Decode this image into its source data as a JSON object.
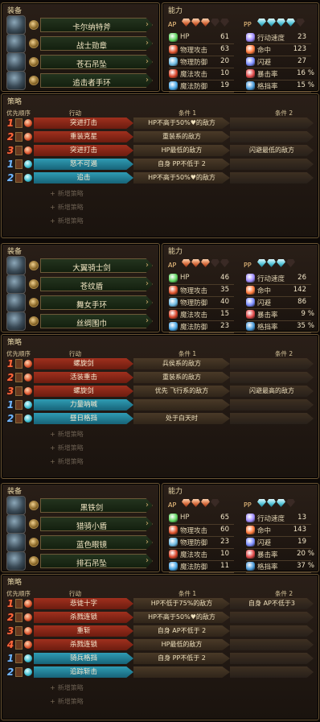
{
  "sections": [
    {
      "equip_title": "装备",
      "stats_title": "能力",
      "ap_label": "AP",
      "pp_label": "PP",
      "ap_filled": 3,
      "ap_total": 5,
      "pp_filled": 4,
      "pp_total": 5,
      "equipment": [
        "卡尔纳特斧",
        "战士勋章",
        "苍石吊坠",
        "追击者手环"
      ],
      "stats_left": [
        {
          "label": "HP",
          "value": "61"
        },
        {
          "label": "物理攻击",
          "value": "63"
        },
        {
          "label": "物理防御",
          "value": "20"
        },
        {
          "label": "魔法攻击",
          "value": "10"
        },
        {
          "label": "魔法防御",
          "value": "19"
        }
      ],
      "stats_right": [
        {
          "label": "行动速度",
          "value": "23"
        },
        {
          "label": "命中",
          "value": "123"
        },
        {
          "label": "闪避",
          "value": "27"
        },
        {
          "label": "暴击率",
          "value": "16",
          "unit": "%"
        },
        {
          "label": "格挡率",
          "value": "15",
          "unit": "%"
        }
      ],
      "strategy_title": "策略",
      "headers": {
        "priority": "优先顺序",
        "action": "行动",
        "cond1": "条件 1",
        "cond2": "条件 2"
      },
      "rows": [
        {
          "prio": "1",
          "type": "red",
          "action": "突进打击",
          "c1": "HP不高于50%♥的敌方",
          "c2": ""
        },
        {
          "prio": "2",
          "type": "red",
          "action": "重装克星",
          "c1": "重装系的敌方",
          "c2": ""
        },
        {
          "prio": "3",
          "type": "red",
          "action": "突进打击",
          "c1": "HP最低的敌方",
          "c2": "闪避最低的敌方"
        },
        {
          "prio": "1",
          "type": "blue",
          "action": "怒不可遏",
          "c1": "自身 PP不低于 2",
          "c2": ""
        },
        {
          "prio": "2",
          "type": "blue",
          "action": "追击",
          "c1": "HP不高于50%♥的敌方",
          "c2": ""
        }
      ],
      "add_label": "新增策略"
    },
    {
      "equip_title": "装备",
      "stats_title": "能力",
      "ap_label": "AP",
      "pp_label": "PP",
      "ap_filled": 3,
      "ap_total": 5,
      "pp_filled": 3,
      "pp_total": 4,
      "equipment": [
        "大翼骑士剑",
        "苍纹盾",
        "舞女手环",
        "丝绸围巾"
      ],
      "stats_left": [
        {
          "label": "HP",
          "value": "46"
        },
        {
          "label": "物理攻击",
          "value": "35"
        },
        {
          "label": "物理防御",
          "value": "40"
        },
        {
          "label": "魔法攻击",
          "value": "15"
        },
        {
          "label": "魔法防御",
          "value": "23"
        }
      ],
      "stats_right": [
        {
          "label": "行动速度",
          "value": "26"
        },
        {
          "label": "命中",
          "value": "142"
        },
        {
          "label": "闪避",
          "value": "86"
        },
        {
          "label": "暴击率",
          "value": "9",
          "unit": "%"
        },
        {
          "label": "格挡率",
          "value": "35",
          "unit": "%"
        }
      ],
      "strategy_title": "策略",
      "headers": {
        "priority": "优先顺序",
        "action": "行动",
        "cond1": "条件 1",
        "cond2": "条件 2"
      },
      "rows": [
        {
          "prio": "1",
          "type": "red",
          "action": "螺旋剑",
          "c1": "兵侯系的敌方",
          "c2": ""
        },
        {
          "prio": "2",
          "type": "red",
          "action": "活装重击",
          "c1": "重装系的敌方",
          "c2": ""
        },
        {
          "prio": "3",
          "type": "red",
          "action": "螺旋剑",
          "c1": "优先 飞行系的敌方",
          "c2": "闪避最高的敌方"
        },
        {
          "prio": "1",
          "type": "blue",
          "action": "力量呐喊",
          "c1": "",
          "c2": ""
        },
        {
          "prio": "2",
          "type": "blue",
          "action": "昼日格挡",
          "c1": "处于白天时",
          "c2": ""
        }
      ],
      "add_label": "新增策略"
    },
    {
      "equip_title": "装备",
      "stats_title": "能力",
      "ap_label": "AP",
      "pp_label": "PP",
      "ap_filled": 3,
      "ap_total": 4,
      "pp_filled": 3,
      "pp_total": 4,
      "equipment": [
        "黑铁剑",
        "猎骑小盾",
        "蓝色眼镜",
        "排石吊坠"
      ],
      "stats_left": [
        {
          "label": "HP",
          "value": "65"
        },
        {
          "label": "物理攻击",
          "value": "60"
        },
        {
          "label": "物理防御",
          "value": "23"
        },
        {
          "label": "魔法攻击",
          "value": "10"
        },
        {
          "label": "魔法防御",
          "value": "11"
        }
      ],
      "stats_right": [
        {
          "label": "行动速度",
          "value": "13"
        },
        {
          "label": "命中",
          "value": "143"
        },
        {
          "label": "闪避",
          "value": "19"
        },
        {
          "label": "暴击率",
          "value": "20",
          "unit": "%"
        },
        {
          "label": "格挡率",
          "value": "37",
          "unit": "%"
        }
      ],
      "strategy_title": "策略",
      "headers": {
        "priority": "优先顺序",
        "action": "行动",
        "cond1": "条件 1",
        "cond2": "条件 2"
      },
      "rows": [
        {
          "prio": "1",
          "type": "red",
          "action": "悲徒十字",
          "c1": "HP不低于75%的敌方",
          "c2": "自身 AP不低于3"
        },
        {
          "prio": "2",
          "type": "red",
          "action": "杀戮连锁",
          "c1": "HP不高于50%♥的敌方",
          "c2": ""
        },
        {
          "prio": "3",
          "type": "red",
          "action": "重斩",
          "c1": "自身 AP不低于 2",
          "c2": ""
        },
        {
          "prio": "4",
          "type": "red",
          "action": "杀戮连锁",
          "c1": "HP最低的敌方",
          "c2": ""
        },
        {
          "prio": "1",
          "type": "blue",
          "action": "骑兵格挡",
          "c1": "自身 PP不低于 2",
          "c2": ""
        },
        {
          "prio": "2",
          "type": "blue",
          "action": "追踪斩击",
          "c1": "",
          "c2": ""
        }
      ],
      "add_label": "新增策略"
    }
  ]
}
